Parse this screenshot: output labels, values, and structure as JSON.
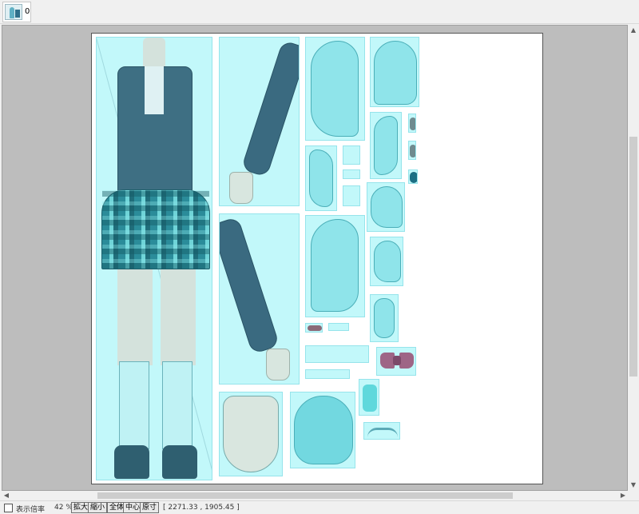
{
  "tabs": [
    {
      "label": "0",
      "thumbnail": "character-texture-thumbnail"
    }
  ],
  "canvas": {
    "background": "#ffffff",
    "part_fill": "#aaf5f8"
  },
  "statusbar": {
    "zoom_label": "表示倍率",
    "zoom_value": "42 %",
    "buttons": {
      "zoom_in": "拡大",
      "zoom_out": "縮小",
      "fit_all": "全体",
      "center": "中心",
      "actual_size": "原寸"
    },
    "coordinates": "[ 2271.33 , 1905.45 ]"
  },
  "icons": {
    "scroll_up": "scroll-up-arrow",
    "scroll_down": "scroll-down-arrow",
    "scroll_left": "scroll-left-arrow",
    "scroll_right": "scroll-right-arrow"
  }
}
